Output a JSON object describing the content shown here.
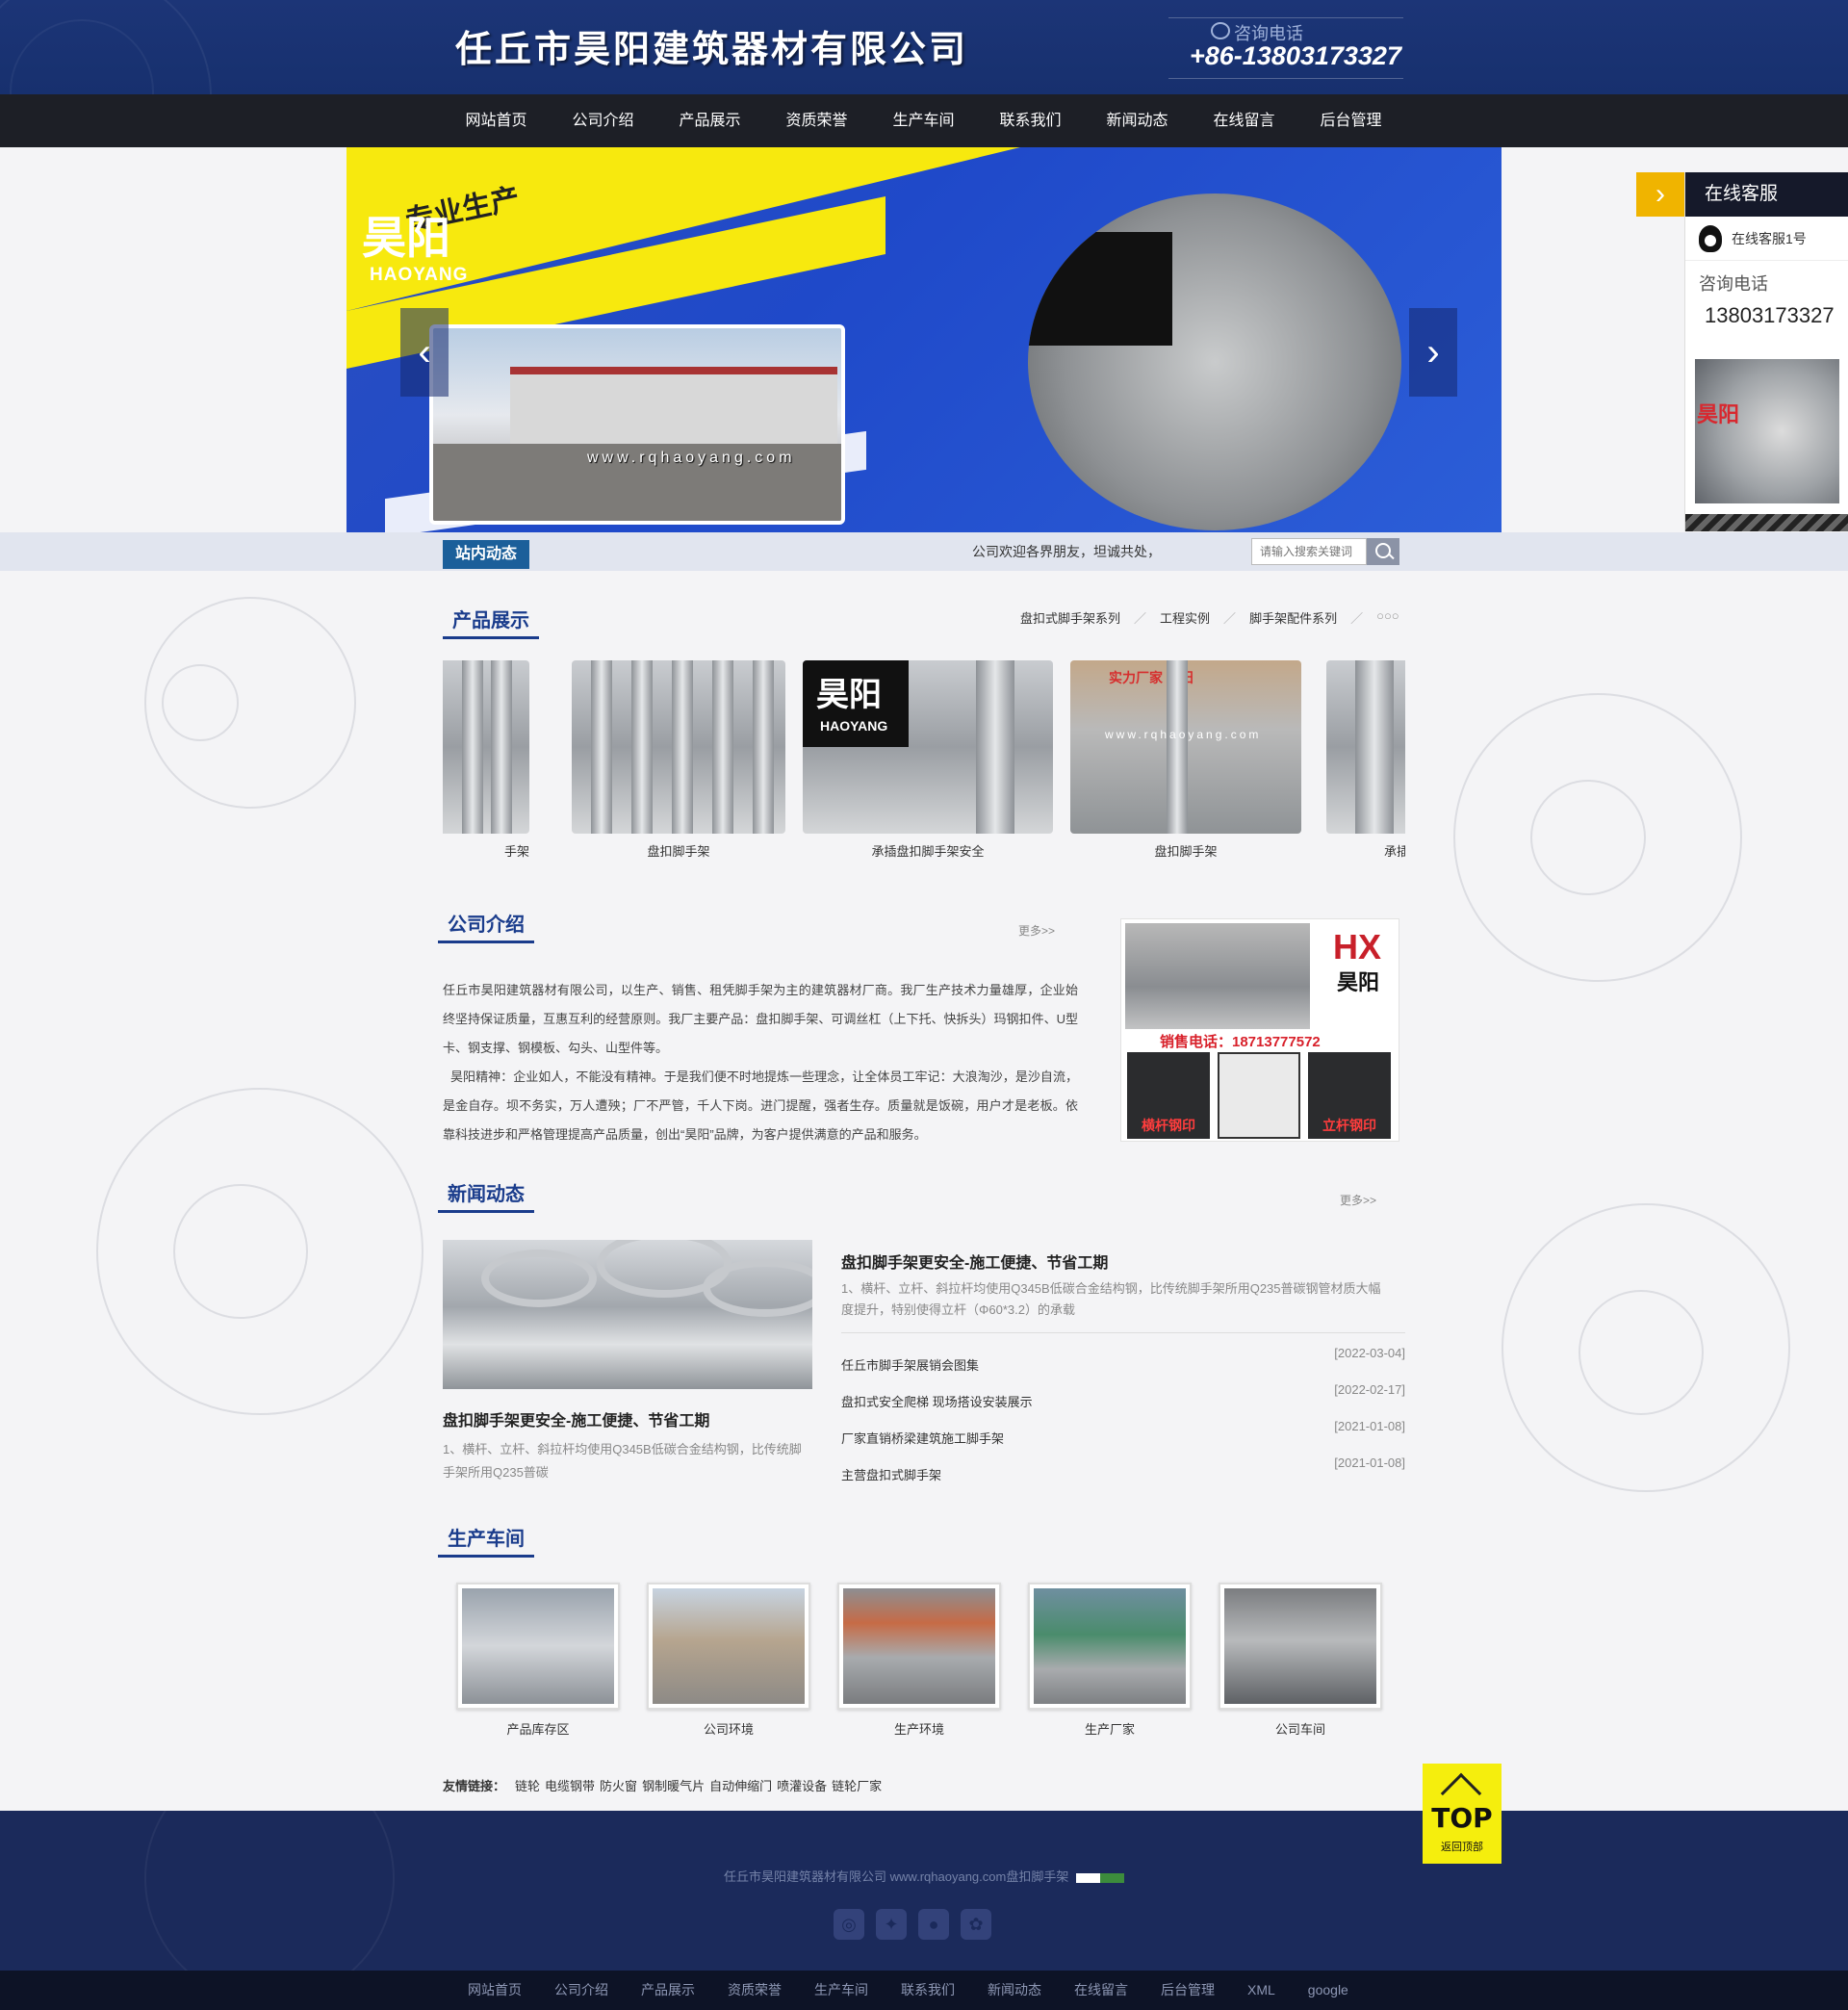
{
  "header": {
    "title": "任丘市昊阳建筑器材有限公司",
    "hotline_label": "咨询电话",
    "hotline_number": "+86-13803173327"
  },
  "nav": {
    "items": [
      "网站首页",
      "公司介绍",
      "产品展示",
      "资质荣誉",
      "生产车间",
      "联系我们",
      "新闻动态",
      "在线留言",
      "后台管理"
    ]
  },
  "banner": {
    "tag": "专业生产",
    "url": "www.rqhaoyang.com",
    "logo_cn": "昊阳",
    "logo_en": "HAOYANG",
    "prev": "‹",
    "next": "›"
  },
  "kefu": {
    "tab_arrow": "›",
    "title": "在线客服",
    "qq_name": "在线客服1号",
    "phone_label": "咨询电话",
    "phone": "13803173327",
    "img_logo": "昊阳"
  },
  "ticker": {
    "tag": "站内动态",
    "text": "公司欢迎各界朋友，坦诚共处，",
    "search_placeholder": "请输入搜索关键词"
  },
  "products": {
    "title": "产品展示",
    "categories": [
      "盘扣式脚手架系列",
      "工程实例",
      "脚手架配件系列"
    ],
    "more_dots": "○○○",
    "items": [
      {
        "caption": "手架"
      },
      {
        "caption": "盘扣脚手架"
      },
      {
        "caption": "承插盘扣脚手架安全",
        "logo_cn": "昊阳",
        "logo_en": "HAOYANG"
      },
      {
        "caption": "盘扣脚手架",
        "stamp": "实力厂家 昊阳",
        "url": "www.rqhaoyang.com"
      },
      {
        "caption": "承插"
      }
    ]
  },
  "intro": {
    "title": "公司介绍",
    "more": "更多>>",
    "paragraphs": [
      "任丘市昊阳建筑器材有限公司，以生产、销售、租凭脚手架为主的建筑器材厂商。我厂生产技术力量雄厚，企业始终坚持保证质量，互惠互利的经营原则。我厂主要产品：盘扣脚手架、可调丝杠（上下托、快拆头）玛钢扣件、U型卡、钢支撑、钢模板、勾头、山型件等。",
      "昊阳精神：企业如人，不能没有精神。于是我们便不时地提炼一些理念，让全体员工牢记：大浪淘沙，是沙自流，是金自存。坝不务实，万人遭殃；厂不严管，千人下岗。进门提醒，强者生存。质量就是饭碗，用户才是老板。依靠科技进步和严格管理提高产品质量，创出“昊阳”品牌，为客户提供满意的产品和服务。"
    ],
    "img_brand": "HX",
    "img_name": "昊阳",
    "img_phone": "销售电话：18713777572",
    "img_tile_left": "横杆钢印",
    "img_tile_right": "立杆钢印"
  },
  "news": {
    "title": "新闻动态",
    "more": "更多>>",
    "left_title": "盘扣脚手架更安全-施工便捷、节省工期",
    "left_desc": "1、横杆、立杆、斜拉杆均使用Q345B低碳合金结构钢，比传统脚手架所用Q235普碳",
    "featured_title": "盘扣脚手架更安全-施工便捷、节省工期",
    "featured_desc": "1、横杆、立杆、斜拉杆均使用Q345B低碳合金结构钢，比传统脚手架所用Q235普碳钢管材质大幅度提升，特别使得立杆（Φ60*3.2）的承载",
    "list": [
      {
        "title": "任丘市脚手架展销会图集",
        "date": "[2022-03-04]"
      },
      {
        "title": "盘扣式安全爬梯 现场搭设安装展示",
        "date": "[2022-02-17]"
      },
      {
        "title": "厂家直销桥梁建筑施工脚手架",
        "date": "[2021-01-08]"
      },
      {
        "title": "主营盘扣式脚手架",
        "date": "[2021-01-08]"
      }
    ]
  },
  "workshop": {
    "title": "生产车间",
    "items": [
      {
        "caption": "产品库存区"
      },
      {
        "caption": "公司环境"
      },
      {
        "caption": "生产环境"
      },
      {
        "caption": "生产厂家"
      },
      {
        "caption": "公司车间"
      }
    ]
  },
  "friends": {
    "label": "友情链接：",
    "links": [
      "链轮",
      "电缆钢带",
      "防火窗",
      "钢制暖气片",
      "自动伸缩门",
      "喷灌设备",
      "链轮厂家"
    ]
  },
  "top_button": {
    "label": "TOP",
    "sub": "返回顶部"
  },
  "footer": {
    "copyright": "任丘市昊阳建筑器材有限公司 www.rqhaoyang.com盘扣脚手架",
    "cnzz": "CNZZ",
    "socials": [
      "weibo-icon",
      "qzone-icon",
      "qq-icon",
      "baidu-icon"
    ]
  },
  "bottom_nav": {
    "items": [
      "网站首页",
      "公司介绍",
      "产品展示",
      "资质荣誉",
      "生产车间",
      "联系我们",
      "新闻动态",
      "在线留言",
      "后台管理",
      "XML",
      "google"
    ]
  },
  "colors": {
    "header_bg": "#1c3577",
    "nav_bg": "#1d1f26",
    "accent_blue": "#1a3c8c",
    "ticker_tag": "#1b5f9a",
    "top_yellow": "#f5ee0d",
    "kefu_tab": "#f0b400",
    "footer_bg": "#1b2a5b"
  }
}
